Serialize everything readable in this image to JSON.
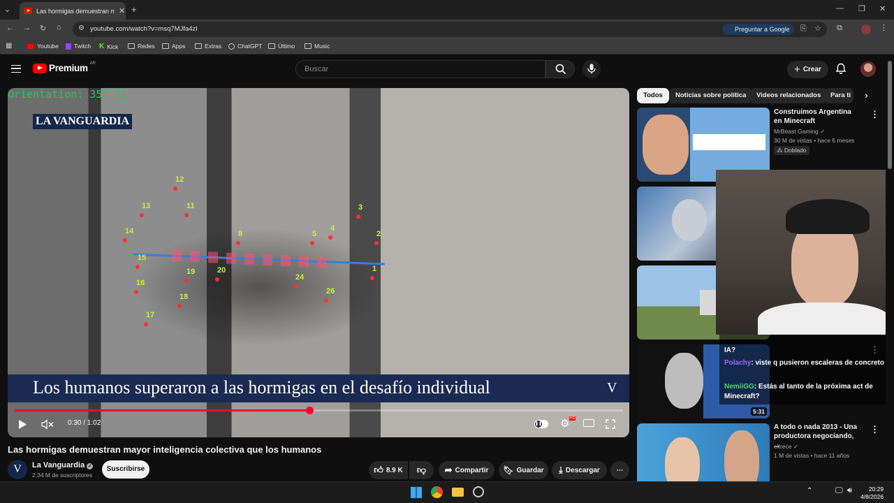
{
  "browser": {
    "tab_title": "Las hormigas demuestran mayor intel",
    "url": "youtube.com/watch?v=msq7MJfa4zI",
    "ask_google": "Preguntar a Google",
    "bookmarks": [
      "Youtube",
      "Twitch",
      "Kick",
      "Redes",
      "Apps",
      "Extras",
      "ChatGPT",
      "Último",
      "Music"
    ]
  },
  "header": {
    "logo_text": "Premium",
    "country": "AR",
    "search_placeholder": "Buscar",
    "create_label": "Crear"
  },
  "video": {
    "orientation_text": "Orientation: 357.62",
    "brand_overlay": "LA VANGUARDIA",
    "headline": "Los humanos superaron a las hormigas en el desafío individual",
    "brand_v": "V",
    "time": "0:30 / 1:02",
    "progress": 0.485,
    "track_labels": [
      "12",
      "13",
      "11",
      "14",
      "8",
      "3",
      "5",
      "4",
      "2",
      "15",
      "19",
      "20",
      "1",
      "16",
      "18",
      "24",
      "26",
      "17"
    ],
    "title": "Las hormigas demuestran mayor inteligencia colectiva que los humanos",
    "channel": "La Vanguardia",
    "channel_initial": "V",
    "subscribers": "2.34 M de suscriptores",
    "subscribe_label": "Suscribirse",
    "likes": "8.9 K",
    "share_label": "Compartir",
    "save_label": "Guardar",
    "download_label": "Descargar"
  },
  "sidebar": {
    "chips": [
      "Todos",
      "Noticias sobre política",
      "Videos relacionados",
      "Para ti"
    ],
    "videos": [
      {
        "title": "Construimos Argentina en Minecraft",
        "channel": "MrBeast Gaming",
        "meta": "30 M de vistas • hace 6 meses",
        "badge": "Doblado"
      },
      {
        "title": "",
        "channel": "",
        "meta": ""
      },
      {
        "title": "",
        "channel": "",
        "meta": ""
      },
      {
        "title": "",
        "channel": "",
        "meta": "",
        "duration": "5:31"
      },
      {
        "title": "A todo o nada 2013 - Una productora negociando, ...",
        "channel": "eltrece",
        "meta": "1 M de vistas • hace 11 años"
      }
    ]
  },
  "stream_chat": [
    {
      "user": "",
      "text": "IA?"
    },
    {
      "user": "Polachy",
      "text": ": viste q pusieron escaleras de concreto"
    },
    {
      "user": "NemiiGG",
      "text": ": Estás al tanto de la próxima act de Minecraft?"
    }
  ],
  "taskbar": {
    "time": "20:29",
    "date": "4/8/2026"
  }
}
